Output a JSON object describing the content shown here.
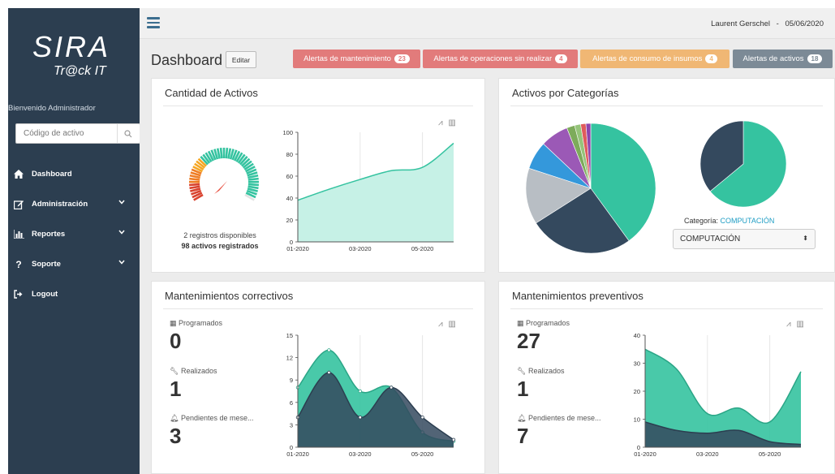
{
  "app": {
    "logo_text_top": "SIRA",
    "logo_text_bottom": "Tr@ck IT"
  },
  "sidebar": {
    "welcome_prefix": "Bienvenido",
    "welcome_user": "Administrador",
    "search_placeholder": "Código de activo",
    "items": [
      {
        "label": "Dashboard",
        "icon": "home-icon"
      },
      {
        "label": "Administración",
        "icon": "edit-icon",
        "chevron": true
      },
      {
        "label": "Reportes",
        "icon": "bar-chart-icon",
        "chevron": true
      },
      {
        "label": "Soporte",
        "icon": "question-icon",
        "chevron": true
      },
      {
        "label": "Logout",
        "icon": "sign-out-icon"
      }
    ]
  },
  "topbar": {
    "user": "Laurent Gerschel",
    "separator": "-",
    "date": "05/06/2020"
  },
  "header": {
    "title": "Dashboard",
    "edit_label": "Editar",
    "alerts": [
      {
        "label": "Alertas de mantenimiento",
        "count": "23",
        "color": "#e27b7b"
      },
      {
        "label": "Alertas de operaciones sin realizar",
        "count": "4",
        "color": "#e27b7b"
      },
      {
        "label": "Alertas de consumo de insumos",
        "count": "4",
        "color": "#f0b774"
      },
      {
        "label": "Alertas de activos",
        "count": "18",
        "color": "#7c8a96"
      }
    ]
  },
  "assets_panel": {
    "title": "Cantidad de Activos",
    "gauge_caption": "2 registros disponibles",
    "gauge_total": "98 activos registrados",
    "gauge_level": 0.98
  },
  "categories_panel": {
    "title": "Activos por Categorías",
    "category_label": "Categoría:",
    "category_value": "COMPUTACIÓN",
    "select_value": "COMPUTACIÓN"
  },
  "corrective_panel": {
    "title": "Mantenimientos correctivos",
    "stats": [
      {
        "label": "Programados",
        "value": "0",
        "icon": "calendar-icon"
      },
      {
        "label": "Realizados",
        "value": "1",
        "icon": "wrench-icon"
      },
      {
        "label": "Pendientes de mese...",
        "value": "3",
        "icon": "bell-icon"
      }
    ]
  },
  "preventive_panel": {
    "title": "Mantenimientos preventivos",
    "stats": [
      {
        "label": "Programados",
        "value": "27",
        "icon": "calendar-icon"
      },
      {
        "label": "Realizados",
        "value": "1",
        "icon": "wrench-icon"
      },
      {
        "label": "Pendientes de mese...",
        "value": "7",
        "icon": "bell-icon"
      }
    ]
  },
  "colors": {
    "sidebar": "#2c3e50",
    "teal": "#35c3a0",
    "teal_fill": "#c6f1e6",
    "navy": "#34495e",
    "gray": "#b8bec4",
    "blue": "#3498db",
    "purple": "#9b59b6"
  },
  "chart_data": [
    {
      "type": "area",
      "ylim": [
        0,
        100
      ],
      "x": [
        "01-2020",
        "02-2020",
        "03-2020",
        "04-2020",
        "05-2020",
        "06-2020"
      ],
      "x_ticks": [
        "01-2020",
        "03-2020",
        "05-2020"
      ],
      "y_ticks": [
        0,
        20,
        40,
        60,
        80,
        100
      ],
      "series": [
        {
          "values": [
            38,
            48,
            57,
            65,
            68,
            90
          ]
        }
      ]
    },
    {
      "type": "pie",
      "slices": [
        {
          "value": 40,
          "color": "#35c3a0"
        },
        {
          "value": 26,
          "color": "#34495e"
        },
        {
          "value": 14,
          "color": "#b8bec4"
        },
        {
          "value": 7,
          "color": "#3498db"
        },
        {
          "value": 7,
          "color": "#9b59b6"
        },
        {
          "value": 2,
          "color": "#7dab5b"
        },
        {
          "value": 1.5,
          "color": "#95c47a"
        },
        {
          "value": 1.3,
          "color": "#e05c5c"
        },
        {
          "value": 1.2,
          "color": "#8e44ad"
        }
      ]
    },
    {
      "type": "pie",
      "slices": [
        {
          "value": 64,
          "color": "#35c3a0"
        },
        {
          "value": 36,
          "color": "#34495e"
        }
      ]
    },
    {
      "type": "area",
      "ylim": [
        0,
        15
      ],
      "x": [
        "01-2020",
        "02-2020",
        "03-2020",
        "04-2020",
        "05-2020",
        "06-2020"
      ],
      "x_ticks": [
        "01-2020",
        "03-2020",
        "05-2020"
      ],
      "y_ticks": [
        0,
        3,
        6,
        9,
        12,
        15
      ],
      "series": [
        {
          "values": [
            8,
            13,
            7.5,
            8,
            2,
            0.8
          ],
          "color": "#35c3a0"
        },
        {
          "values": [
            4,
            10,
            4,
            8,
            4,
            1
          ],
          "color": "#34495e"
        }
      ]
    },
    {
      "type": "area",
      "ylim": [
        0,
        40
      ],
      "x": [
        "01-2020",
        "02-2020",
        "03-2020",
        "04-2020",
        "05-2020",
        "06-2020"
      ],
      "x_ticks": [
        "01-2020",
        "03-2020",
        "05-2020"
      ],
      "y_ticks": [
        0,
        10,
        20,
        30,
        40
      ],
      "series": [
        {
          "values": [
            35,
            28,
            12,
            14,
            9,
            27
          ],
          "color": "#35c3a0"
        },
        {
          "values": [
            9,
            6,
            5,
            6,
            2,
            1
          ],
          "color": "#34495e"
        }
      ]
    }
  ]
}
